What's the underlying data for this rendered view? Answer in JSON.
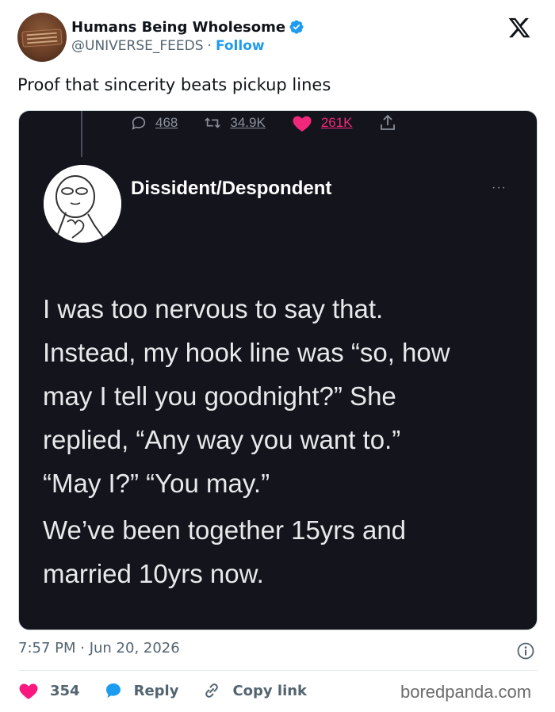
{
  "account": {
    "name": "Humans Being Wholesome",
    "handle": "@UNIVERSE_FEEDS",
    "separator": "·",
    "follow_label": "Follow",
    "verified": true
  },
  "tweet": {
    "text": "Proof that sincerity beats pickup lines",
    "timestamp": "7:57 PM · Jun 20, 2026"
  },
  "embedded_post": {
    "stats": [
      {
        "icon": "reply-icon",
        "value": "468"
      },
      {
        "icon": "retweet-icon",
        "value": "34.9K"
      },
      {
        "icon": "heart-icon",
        "value": "261K"
      },
      {
        "icon": "share-icon",
        "value": ""
      }
    ],
    "author": "Dissident/Despondent",
    "more_label": "···",
    "paragraphs": [
      [
        "I was too nervous to say that.",
        "Instead, my hook line was “so, how",
        "may I tell you goodnight?” She",
        "replied, “Any way you want to.”",
        "“May I?” “You may.”"
      ],
      [
        "We’ve been together 15yrs and",
        "married 10yrs now."
      ]
    ]
  },
  "actions": {
    "likes": "354",
    "reply_label": "Reply",
    "copy_link_label": "Copy link"
  },
  "brand": "boredpanda.com",
  "colors": {
    "accent": "#1d9bf0",
    "like": "#f91880",
    "dark_bg": "#13141c"
  }
}
